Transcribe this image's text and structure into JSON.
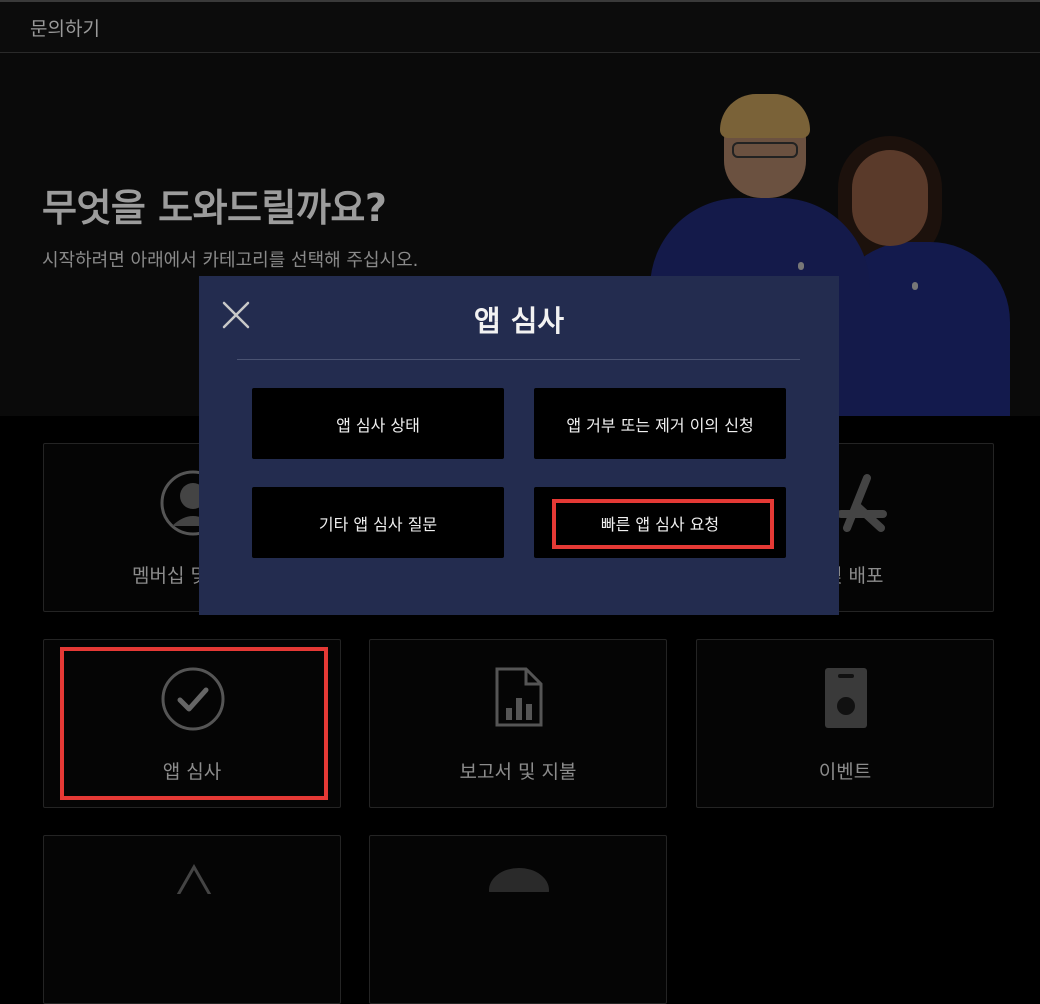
{
  "topbar": {
    "title": "문의하기"
  },
  "hero": {
    "title": "무엇을 도와드릴까요?",
    "subtitle": "시작하려면 아래에서 카테고리를 선택해 주십시오."
  },
  "cards": {
    "membership": {
      "label": "멤버십 및",
      "icon": "person-icon"
    },
    "distribution": {
      "label": "및 배포",
      "icon": "app-store-icon"
    },
    "app_review": {
      "label": "앱 심사",
      "icon": "checkmark-circle-icon"
    },
    "reports": {
      "label": "보고서 및 지불",
      "icon": "report-chart-icon"
    },
    "events": {
      "label": "이벤트",
      "icon": "badge-icon"
    }
  },
  "modal": {
    "title": "앱 심사",
    "close_icon": "close-icon",
    "buttons": [
      {
        "label": "앱 심사 상태"
      },
      {
        "label": "앱 거부 또는 제거 이의 신청"
      },
      {
        "label": "기타 앱 심사 질문"
      },
      {
        "label": "빠른 앱 심사 요청"
      }
    ]
  },
  "colors": {
    "modal_bg": "#232c4f",
    "highlight": "#e53935",
    "button_bg": "#000000"
  }
}
